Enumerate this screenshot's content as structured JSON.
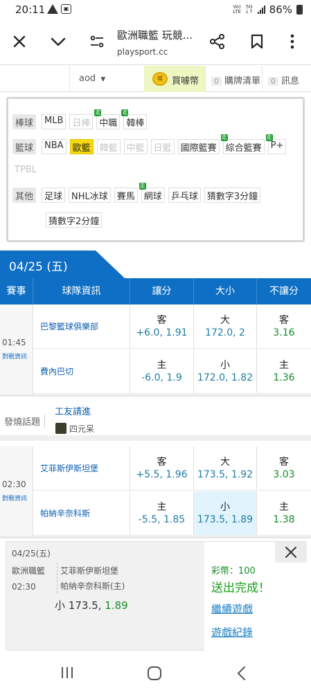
{
  "status_bar": {
    "time": "20:11",
    "network": "VoLTE 5G",
    "battery": "86%"
  },
  "browser": {
    "title": "歐洲職籃 玩競...",
    "url": "playsport.cc"
  },
  "site_header": {
    "user": "aod",
    "buy_coin": "買噱幣",
    "coin_badge": "噱",
    "ticket_count": "0",
    "ticket_label": "購牌清單",
    "msg_count": "0",
    "msg_label": "訊息"
  },
  "sport_filter": {
    "baseball": {
      "label": "棒球",
      "items": [
        "MLB",
        "日棒",
        "中職",
        "韓棒"
      ]
    },
    "basketball": {
      "label": "籃球",
      "items": [
        "NBA",
        "歐籃",
        "韓籃",
        "中籃",
        "日籃",
        "國際籃賽",
        "綜合籃賽",
        "P+",
        "TPBL"
      ]
    },
    "other": {
      "label": "其他",
      "items": [
        "足球",
        "NHL冰球",
        "賽馬",
        "網球",
        "乒乓球",
        "猜數字3分鐘",
        "猜數字2分鐘"
      ]
    },
    "tag_label": "走"
  },
  "date": "04/25 (五)",
  "table_headers": [
    "賽事",
    "球隊資訊",
    "讓分",
    "大小",
    "不讓分"
  ],
  "games": [
    {
      "time": "01:45",
      "match_link": "對戰資訊",
      "away": {
        "team": "巴黎籃球俱樂部",
        "spread_side": "客",
        "spread": "+6.0, 1.91",
        "total_side": "大",
        "total": "172.0, 2",
        "ml_side": "客",
        "ml": "3.16"
      },
      "home": {
        "team": "費內巴切",
        "spread_side": "主",
        "spread": "-6.0, 1.9",
        "total_side": "小",
        "total": "172.0, 1.82",
        "ml_side": "主",
        "ml": "1.36"
      }
    },
    {
      "time": "02:30",
      "match_link": "對戰資訊",
      "away": {
        "team": "艾菲斯伊斯坦堡",
        "spread_side": "客",
        "spread": "+5.5, 1.96",
        "total_side": "大",
        "total": "173.5, 1.92",
        "ml_side": "客",
        "ml": "3.03"
      },
      "home": {
        "team": "帕納辛奈科斯",
        "spread_side": "主",
        "spread": "-5.5, 1.85",
        "total_side": "小",
        "total": "173.5, 1.89",
        "ml_side": "主",
        "ml": "1.38"
      }
    }
  ],
  "hot_topic": {
    "label": "發燒話題",
    "title": "工友請進",
    "author": "四元呆"
  },
  "bet_confirm": {
    "date": "04/25(五)",
    "league": "歐洲職籃",
    "time": "02:30",
    "team1": "艾菲斯伊斯坦堡",
    "team2": "帕納辛奈科斯(主)",
    "pick_side": "小",
    "pick_line": "173.5,",
    "pick_odds": "1.89",
    "stake": "彩幣：100",
    "status": "送出完成！",
    "continue": "繼續遊戲",
    "history": "遊戲紀錄"
  },
  "colors": {
    "primary": "#0f6fc4",
    "highlight": "#e1f3fd",
    "success": "#1a9e1a",
    "selected_chip": "#f5d90a"
  }
}
